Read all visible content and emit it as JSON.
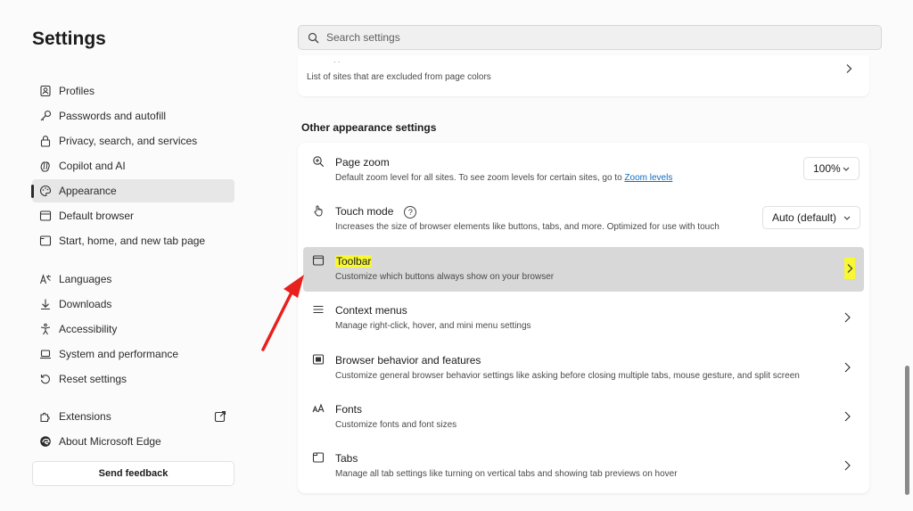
{
  "sidebar": {
    "title": "Settings",
    "items": [
      {
        "label": "Profiles",
        "icon": "profile-icon"
      },
      {
        "label": "Passwords and autofill",
        "icon": "key-icon"
      },
      {
        "label": "Privacy, search, and services",
        "icon": "lock-icon"
      },
      {
        "label": "Copilot and AI",
        "icon": "copilot-icon"
      },
      {
        "label": "Appearance",
        "icon": "palette-icon",
        "active": true
      },
      {
        "label": "Default browser",
        "icon": "browser-icon"
      },
      {
        "label": "Start, home, and new tab page",
        "icon": "home-icon"
      },
      {
        "label": "Languages",
        "icon": "languages-icon"
      },
      {
        "label": "Downloads",
        "icon": "download-icon"
      },
      {
        "label": "Accessibility",
        "icon": "accessibility-icon"
      },
      {
        "label": "System and performance",
        "icon": "laptop-icon"
      },
      {
        "label": "Reset settings",
        "icon": "reset-icon"
      },
      {
        "label": "Extensions",
        "icon": "puzzle-icon"
      },
      {
        "label": "About Microsoft Edge",
        "icon": "edge-icon"
      }
    ],
    "feedback_label": "Send feedback"
  },
  "search": {
    "placeholder": "Search settings"
  },
  "top_card": {
    "description": "List of sites that are excluded from page colors"
  },
  "section": {
    "title": "Other appearance settings"
  },
  "rows": {
    "page_zoom": {
      "title": "Page zoom",
      "desc": "Default zoom level for all sites. To see zoom levels for certain sites, go to ",
      "link": "Zoom levels",
      "value": "100%"
    },
    "touch_mode": {
      "title": "Touch mode",
      "help": "?",
      "desc": "Increases the size of browser elements like buttons, tabs, and more. Optimized for use with touch",
      "value": "Auto (default)"
    },
    "toolbar": {
      "title": "Toolbar",
      "desc": "Customize which buttons always show on your browser"
    },
    "context_menus": {
      "title": "Context menus",
      "desc": "Manage right-click, hover, and mini menu settings"
    },
    "browser_behavior": {
      "title": "Browser behavior and features",
      "desc": "Customize general browser behavior settings like asking before closing multiple tabs, mouse gesture, and split screen"
    },
    "fonts": {
      "title": "Fonts",
      "desc": "Customize fonts and font sizes"
    },
    "tabs": {
      "title": "Tabs",
      "desc": "Manage all tab settings like turning on vertical tabs and showing tab previews on hover"
    }
  },
  "colors": {
    "highlight": "#f7f734",
    "arrow": "#e8201e",
    "link": "#0f6cbd",
    "selected_row": "#d8d8d8"
  }
}
